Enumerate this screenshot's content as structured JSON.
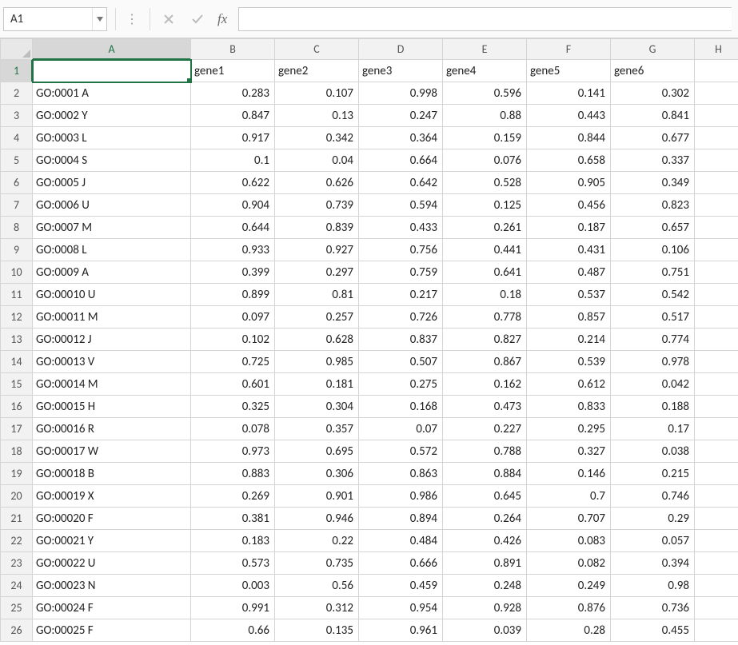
{
  "formula_bar": {
    "name_box": "A1",
    "cancel_icon": "cancel-icon",
    "confirm_icon": "confirm-icon",
    "fx_label": "fx",
    "formula_value": ""
  },
  "columns": [
    "A",
    "B",
    "C",
    "D",
    "E",
    "F",
    "G",
    "H"
  ],
  "header_row": [
    "",
    "gene1",
    "gene2",
    "gene3",
    "gene4",
    "gene5",
    "gene6",
    ""
  ],
  "rows": [
    {
      "n": 2,
      "label": "GO:0001 A",
      "v": [
        0.283,
        0.107,
        0.998,
        0.596,
        0.141,
        0.302
      ]
    },
    {
      "n": 3,
      "label": "GO:0002 Y",
      "v": [
        0.847,
        0.13,
        0.247,
        0.88,
        0.443,
        0.841
      ]
    },
    {
      "n": 4,
      "label": "GO:0003 L",
      "v": [
        0.917,
        0.342,
        0.364,
        0.159,
        0.844,
        0.677
      ]
    },
    {
      "n": 5,
      "label": "GO:0004 S",
      "v": [
        0.1,
        0.04,
        0.664,
        0.076,
        0.658,
        0.337
      ]
    },
    {
      "n": 6,
      "label": "GO:0005 J",
      "v": [
        0.622,
        0.626,
        0.642,
        0.528,
        0.905,
        0.349
      ]
    },
    {
      "n": 7,
      "label": "GO:0006 U",
      "v": [
        0.904,
        0.739,
        0.594,
        0.125,
        0.456,
        0.823
      ]
    },
    {
      "n": 8,
      "label": "GO:0007 M",
      "v": [
        0.644,
        0.839,
        0.433,
        0.261,
        0.187,
        0.657
      ]
    },
    {
      "n": 9,
      "label": "GO:0008 L",
      "v": [
        0.933,
        0.927,
        0.756,
        0.441,
        0.431,
        0.106
      ]
    },
    {
      "n": 10,
      "label": "GO:0009 A",
      "v": [
        0.399,
        0.297,
        0.759,
        0.641,
        0.487,
        0.751
      ]
    },
    {
      "n": 11,
      "label": "GO:00010 U",
      "v": [
        0.899,
        0.81,
        0.217,
        0.18,
        0.537,
        0.542
      ]
    },
    {
      "n": 12,
      "label": "GO:00011 M",
      "v": [
        0.097,
        0.257,
        0.726,
        0.778,
        0.857,
        0.517
      ]
    },
    {
      "n": 13,
      "label": "GO:00012 J",
      "v": [
        0.102,
        0.628,
        0.837,
        0.827,
        0.214,
        0.774
      ]
    },
    {
      "n": 14,
      "label": "GO:00013 V",
      "v": [
        0.725,
        0.985,
        0.507,
        0.867,
        0.539,
        0.978
      ]
    },
    {
      "n": 15,
      "label": "GO:00014 M",
      "v": [
        0.601,
        0.181,
        0.275,
        0.162,
        0.612,
        0.042
      ]
    },
    {
      "n": 16,
      "label": "GO:00015 H",
      "v": [
        0.325,
        0.304,
        0.168,
        0.473,
        0.833,
        0.188
      ]
    },
    {
      "n": 17,
      "label": "GO:00016 R",
      "v": [
        0.078,
        0.357,
        0.07,
        0.227,
        0.295,
        0.17
      ]
    },
    {
      "n": 18,
      "label": "GO:00017 W",
      "v": [
        0.973,
        0.695,
        0.572,
        0.788,
        0.327,
        0.038
      ]
    },
    {
      "n": 19,
      "label": "GO:00018 B",
      "v": [
        0.883,
        0.306,
        0.863,
        0.884,
        0.146,
        0.215
      ]
    },
    {
      "n": 20,
      "label": "GO:00019 X",
      "v": [
        0.269,
        0.901,
        0.986,
        0.645,
        0.7,
        0.746
      ]
    },
    {
      "n": 21,
      "label": "GO:00020 F",
      "v": [
        0.381,
        0.946,
        0.894,
        0.264,
        0.707,
        0.29
      ]
    },
    {
      "n": 22,
      "label": "GO:00021 Y",
      "v": [
        0.183,
        0.22,
        0.484,
        0.426,
        0.083,
        0.057
      ]
    },
    {
      "n": 23,
      "label": "GO:00022 U",
      "v": [
        0.573,
        0.735,
        0.666,
        0.891,
        0.082,
        0.394
      ]
    },
    {
      "n": 24,
      "label": "GO:00023 N",
      "v": [
        0.003,
        0.56,
        0.459,
        0.248,
        0.249,
        0.98
      ]
    },
    {
      "n": 25,
      "label": "GO:00024 F",
      "v": [
        0.991,
        0.312,
        0.954,
        0.928,
        0.876,
        0.736
      ]
    },
    {
      "n": 26,
      "label": "GO:00025 F",
      "v": [
        0.66,
        0.135,
        0.961,
        0.039,
        0.28,
        0.455
      ]
    }
  ],
  "active_cell": {
    "row": 1,
    "col": "A"
  }
}
